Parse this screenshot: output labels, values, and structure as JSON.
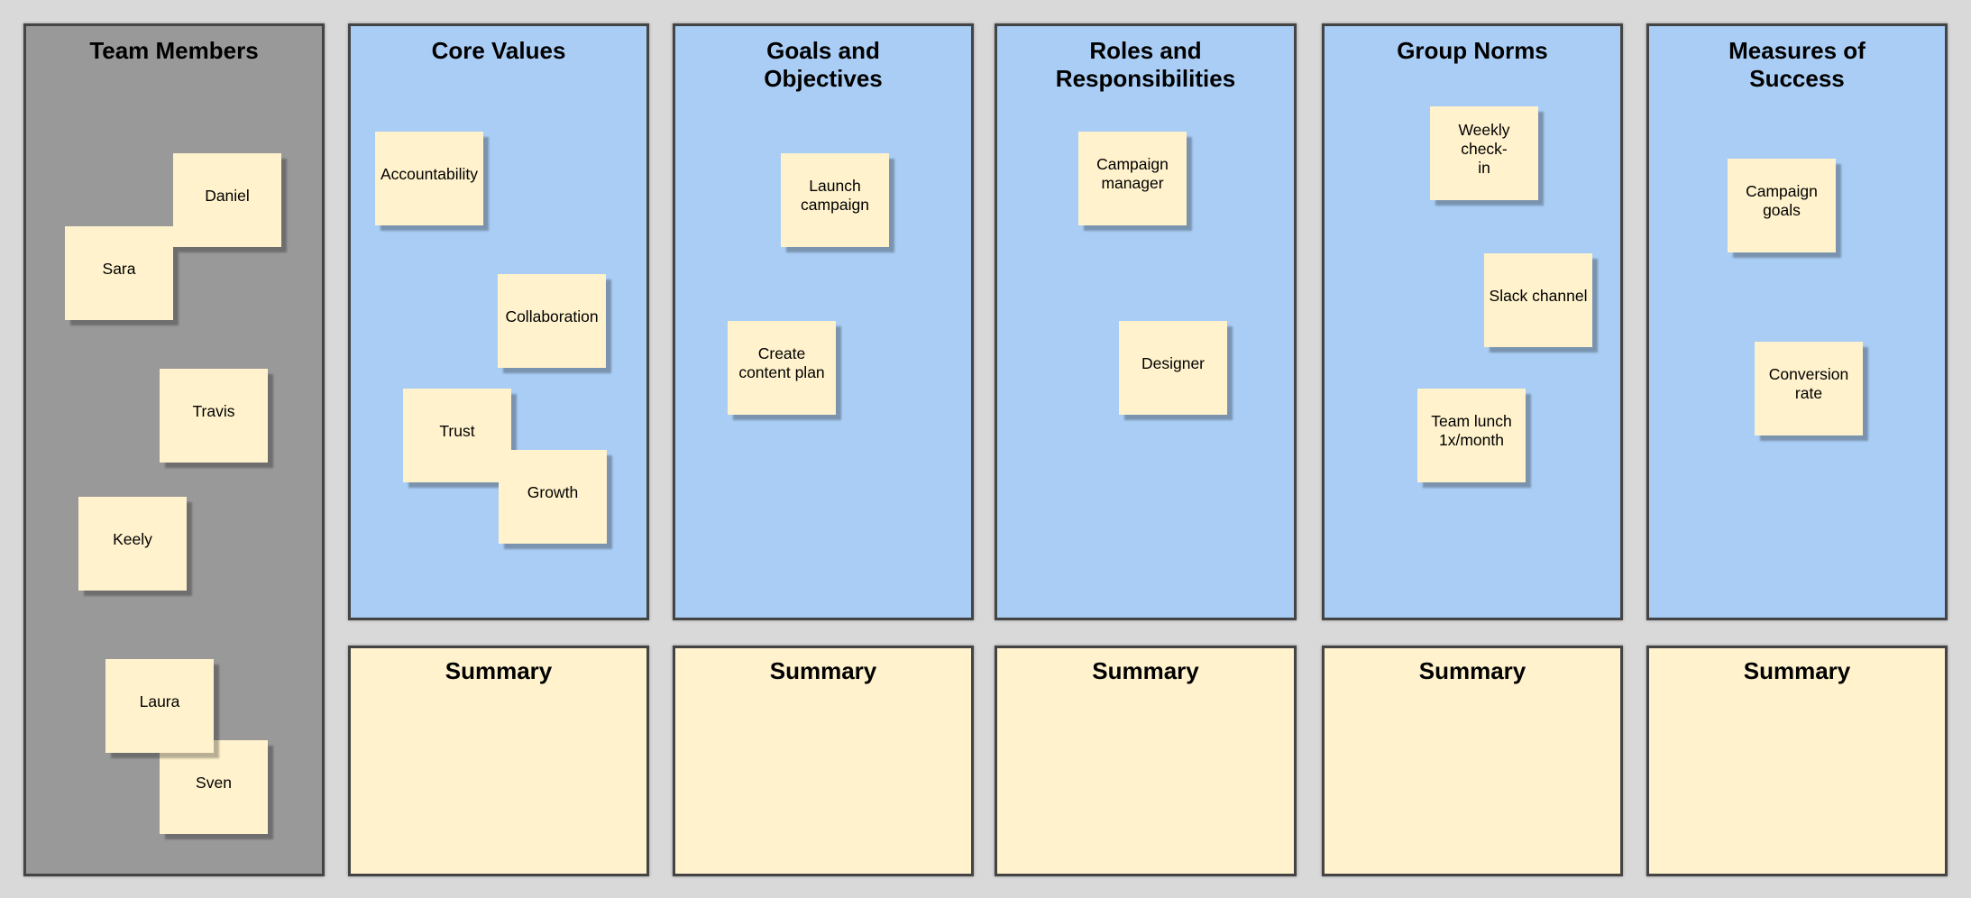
{
  "board": {
    "colors": {
      "background": "#d9d9d9",
      "team_panel": "#999999",
      "column_panel": "#a9cdf4",
      "summary_panel": "#fff2cc",
      "sticky_note": "#fff2cc",
      "border": "#444444"
    },
    "team_members": {
      "title": "Team Members",
      "notes": [
        "Daniel",
        "Sara",
        "Travis",
        "Keely",
        "Laura",
        "Sven"
      ]
    },
    "columns": [
      {
        "title": "Core Values",
        "notes": [
          "Accountability",
          "Collaboration",
          "Trust",
          "Growth"
        ],
        "summary_title": "Summary"
      },
      {
        "title": "Goals and Objectives",
        "notes": [
          "Launch campaign",
          "Create content plan"
        ],
        "summary_title": "Summary"
      },
      {
        "title": "Roles and Responsibilities",
        "notes": [
          "Campaign manager",
          "Designer"
        ],
        "summary_title": "Summary"
      },
      {
        "title": "Group Norms",
        "notes": [
          "Weekly check-in",
          "Slack channel",
          "Team lunch 1x/month"
        ],
        "summary_title": "Summary"
      },
      {
        "title": "Measures of Success",
        "notes": [
          "Campaign goals",
          "Conversion rate"
        ],
        "summary_title": "Summary"
      }
    ]
  }
}
